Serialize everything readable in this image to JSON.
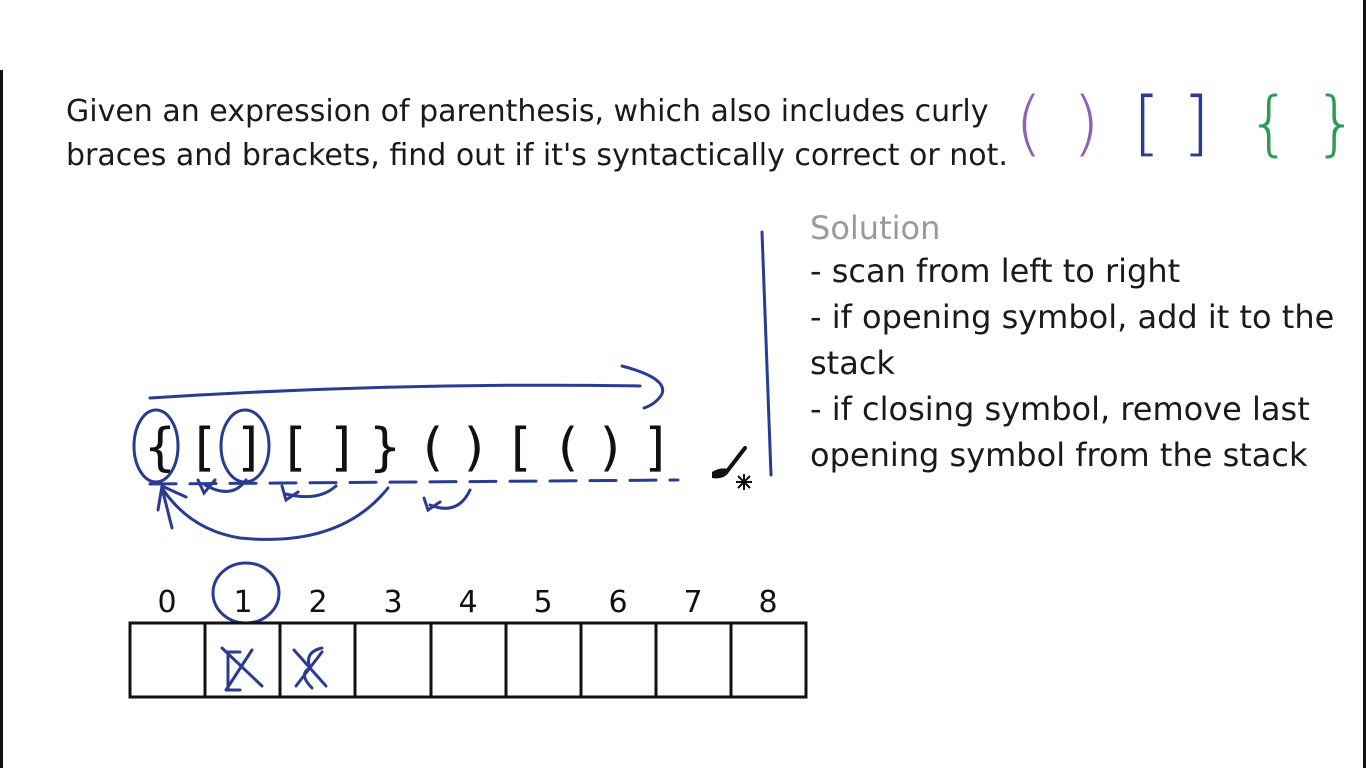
{
  "problem": {
    "line1": "Given an expression of parenthesis, which also includes curly",
    "line2": "braces and brackets, find out if it's syntactically correct or not."
  },
  "bracket_legend": [
    {
      "glyphs": "( )",
      "color": "#8e62b7"
    },
    {
      "glyphs": "[ ]",
      "color": "#2a3c92"
    },
    {
      "glyphs": "{ }",
      "color": "#2f9a52"
    }
  ],
  "solution": {
    "title": "Solution",
    "steps": [
      "- scan from left to right",
      "- if opening symbol, add it to the stack",
      "- if closing symbol, remove last opening symbol from the stack"
    ]
  },
  "expression": [
    "{",
    "[",
    "]",
    "[",
    "]",
    "}",
    "(",
    ")",
    "[",
    "(",
    ")",
    "]"
  ],
  "stack": {
    "indices": [
      "0",
      "1",
      "2",
      "3",
      "4",
      "5",
      "6",
      "7",
      "8"
    ]
  },
  "colors": {
    "ink": "#2a3c92",
    "text": "#111111"
  },
  "icons": [
    "paint-brush-cursor-icon"
  ]
}
